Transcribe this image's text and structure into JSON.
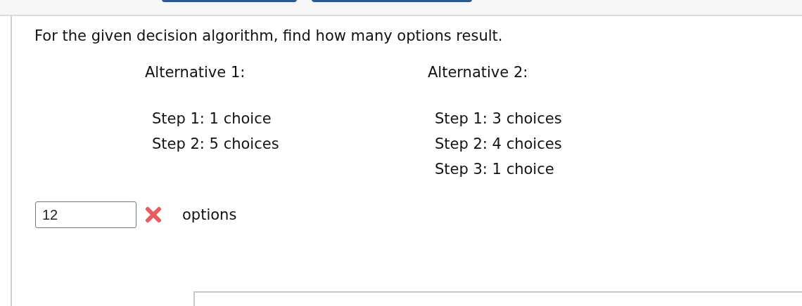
{
  "question": "For the given decision algorithm, find how many options result.",
  "alternatives": [
    {
      "title": "Alternative 1:",
      "steps": [
        "Step 1: 1 choice",
        "Step 2: 5 choices"
      ]
    },
    {
      "title": "Alternative 2:",
      "steps": [
        "Step 1: 3 choices",
        "Step 2: 4 choices",
        "Step 3: 1 choice"
      ]
    }
  ],
  "answer": {
    "value": "12",
    "correct": false,
    "unit": "options"
  }
}
